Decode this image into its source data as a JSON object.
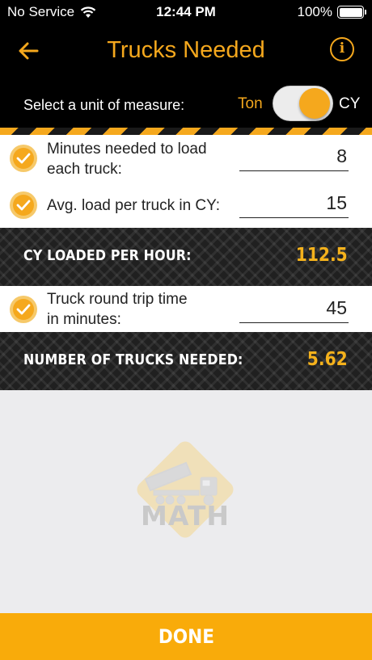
{
  "status_bar": {
    "carrier": "No Service",
    "time": "12:44 PM",
    "battery": "100%"
  },
  "nav": {
    "title": "Trucks Needed",
    "back_icon": "arrow-left-icon",
    "info_icon": "info-icon"
  },
  "unit_selector": {
    "label": "Select a unit of measure:",
    "option_left": "Ton",
    "option_right": "CY",
    "selected": "CY"
  },
  "inputs": [
    {
      "label_line1": "Minutes needed to load",
      "label_line2": "each truck:",
      "value": "8"
    },
    {
      "label_line1": "Avg. load per truck in CY:",
      "value": "15"
    },
    {
      "label_line1": "Truck round trip time",
      "label_line2": "in minutes:",
      "value": "45"
    }
  ],
  "results": [
    {
      "label": "CY LOADED PER HOUR:",
      "value": "112.5"
    },
    {
      "label": "NUMBER OF TRUCKS NEEDED:",
      "value": "5.62"
    }
  ],
  "watermark": {
    "text": "MATH",
    "icon": "dump-truck-sign-icon"
  },
  "done_button": {
    "label": "DONE"
  },
  "colors": {
    "accent": "#f5a81d",
    "done": "#f9ab0a",
    "header_bg": "#000000",
    "result_value": "#f5b21c"
  }
}
